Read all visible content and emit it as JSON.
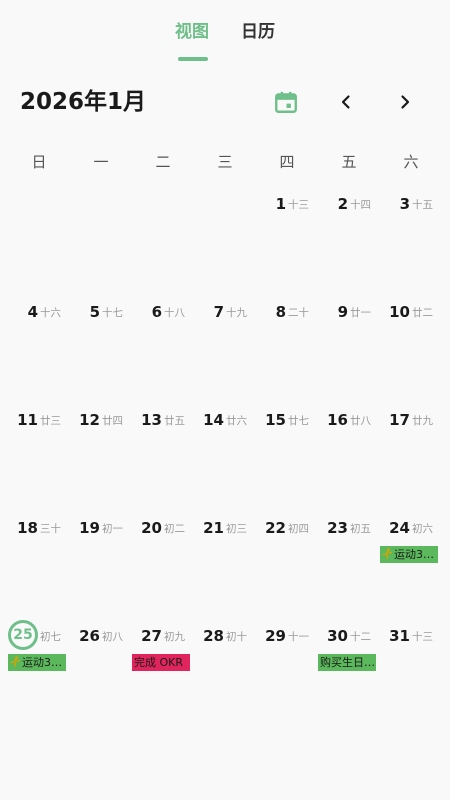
{
  "tabs": {
    "view_label": "视图",
    "calendar_label": "日历"
  },
  "header": {
    "month_title": "2026年1月"
  },
  "weekdays": [
    "日",
    "一",
    "二",
    "三",
    "四",
    "五",
    "六"
  ],
  "today": 25,
  "colors": {
    "accent": "#6fbf8a",
    "event_green": "#5cb85c",
    "event_pink": "#e0245e"
  },
  "weeks": [
    [
      null,
      null,
      null,
      null,
      {
        "day": "1",
        "lunar": "十三"
      },
      {
        "day": "2",
        "lunar": "十四"
      },
      {
        "day": "3",
        "lunar": "十五"
      }
    ],
    [
      {
        "day": "4",
        "lunar": "十六"
      },
      {
        "day": "5",
        "lunar": "十七"
      },
      {
        "day": "6",
        "lunar": "十八"
      },
      {
        "day": "7",
        "lunar": "十九"
      },
      {
        "day": "8",
        "lunar": "二十"
      },
      {
        "day": "9",
        "lunar": "廿一"
      },
      {
        "day": "10",
        "lunar": "廿二"
      }
    ],
    [
      {
        "day": "11",
        "lunar": "廿三"
      },
      {
        "day": "12",
        "lunar": "廿四"
      },
      {
        "day": "13",
        "lunar": "廿五"
      },
      {
        "day": "14",
        "lunar": "廿六"
      },
      {
        "day": "15",
        "lunar": "廿七"
      },
      {
        "day": "16",
        "lunar": "廿八"
      },
      {
        "day": "17",
        "lunar": "廿九"
      }
    ],
    [
      {
        "day": "18",
        "lunar": "三十"
      },
      {
        "day": "19",
        "lunar": "初一"
      },
      {
        "day": "20",
        "lunar": "初二"
      },
      {
        "day": "21",
        "lunar": "初三"
      },
      {
        "day": "22",
        "lunar": "初四"
      },
      {
        "day": "23",
        "lunar": "初五"
      },
      {
        "day": "24",
        "lunar": "初六",
        "event": {
          "text": "运动3…",
          "icon": "runner-icon",
          "color": "green"
        }
      }
    ],
    [
      {
        "day": "25",
        "lunar": "初七",
        "today": true,
        "event": {
          "text": "运动3…",
          "icon": "runner-icon",
          "color": "green"
        }
      },
      {
        "day": "26",
        "lunar": "初八"
      },
      {
        "day": "27",
        "lunar": "初九",
        "event": {
          "text": "完成 OKR",
          "color": "pink"
        }
      },
      {
        "day": "28",
        "lunar": "初十"
      },
      {
        "day": "29",
        "lunar": "十一"
      },
      {
        "day": "30",
        "lunar": "十二",
        "event": {
          "text": "购买生日…",
          "color": "green"
        }
      },
      {
        "day": "31",
        "lunar": "十三"
      }
    ]
  ]
}
